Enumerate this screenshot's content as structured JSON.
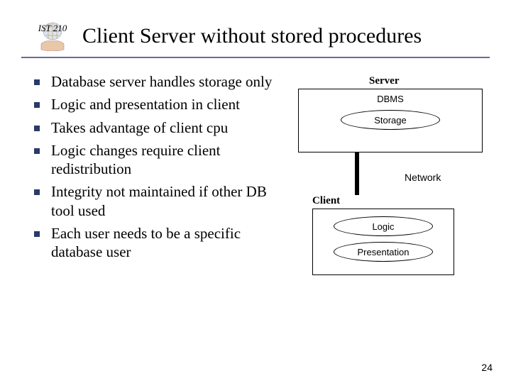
{
  "header": {
    "course": "IST 210",
    "title": "Client Server without stored procedures"
  },
  "bullets": [
    "Database server handles storage only",
    "Logic and presentation in client",
    "Takes advantage of client cpu",
    "Logic changes require client redistribution",
    "Integrity not maintained if other DB tool used",
    "Each user needs to be a specific database user"
  ],
  "diagram": {
    "server_label": "Server",
    "dbms": "DBMS",
    "storage": "Storage",
    "network": "Network",
    "client_label": "Client",
    "logic": "Logic",
    "presentation": "Presentation"
  },
  "page_number": "24"
}
